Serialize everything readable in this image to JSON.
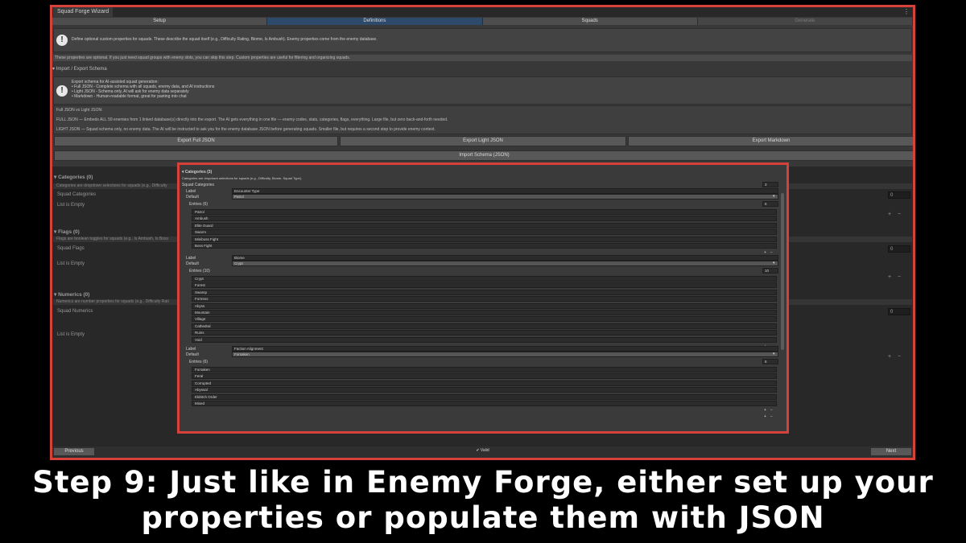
{
  "window": {
    "title": "Squad Forge Wizard",
    "menu_icon": "kebab-icon"
  },
  "tabs": [
    {
      "label": "Setup",
      "state": "normal"
    },
    {
      "label": "Definitions",
      "state": "active"
    },
    {
      "label": "Squads",
      "state": "normal"
    },
    {
      "label": "Generate",
      "state": "disabled"
    }
  ],
  "intro": {
    "help": "Define optional custom properties for squads. These describe the squad itself (e.g., Difficulty Rating, Biome, Is Ambush). Enemy properties come from the enemy database.",
    "note": "These properties are optional. If you just need squad groups with enemy slots, you can skip this step. Custom properties are useful for filtering and organizing squads."
  },
  "import_export": {
    "heading": "Import / Export Schema",
    "help": "Export schema for AI-assisted squad generation:\n• Full JSON - Complete schema with all squads, enemy data, and AI instructions\n• Light JSON - Schema only, AI will ask for enemy data separately\n• Markdown - Human-readable format, great for pasting into chat",
    "compare_title": "Full JSON vs Light JSON:",
    "full_desc": "FULL JSON — Embeds ALL 59 enemies from 1 linked database(s) directly into the export. The AI gets everything in one file — enemy codes, stats, categories, flags, everything. Large file, but zero back-and-forth needed.",
    "light_desc": "LIGHT JSON — Squad schema only, no enemy data. The AI will be instructed to ask you for the enemy database JSON before generating squads. Smaller file, but requires a second step to provide enemy context.",
    "export_full": "Export Full JSON",
    "export_light": "Export Light JSON",
    "export_md": "Export Markdown",
    "import": "Import Schema (JSON)"
  },
  "categories": {
    "heading": "Categories (0)",
    "desc": "Categories are dropdown selections for squads (e.g., Difficulty",
    "label": "Squad Categories",
    "count": "0",
    "empty": "List is Empty"
  },
  "flags": {
    "heading": "Flags (0)",
    "desc": "Flags are boolean toggles for squads (e.g., Is Ambush, Is Boss",
    "label": "Squad Flags",
    "count": "0",
    "empty": "List is Empty"
  },
  "numerics": {
    "heading": "Numerics (0)",
    "desc": "Numerics are number properties for squads (e.g., Difficulty Rati",
    "label": "Squad Numerics",
    "count": "0",
    "empty": "List is Empty"
  },
  "footer": {
    "previous": "Previous",
    "valid": "✔ Valid",
    "next": "Next"
  },
  "inset": {
    "heading": "Categories (3)",
    "desc": "Categories are dropdown selections for squads (e.g., Difficulty, Biome, Squad Type).",
    "list_label": "Squad Categories",
    "list_count": "3",
    "label_key": "Label",
    "default_key": "Default",
    "entries_key": "Entries",
    "groups": [
      {
        "label": "Encounter Type",
        "default": "Patrol",
        "entries_count": "(6)",
        "count": "6",
        "entries": [
          "Patrol",
          "Ambush",
          "Elite Guard",
          "Swarm",
          "Miniboss Fight",
          "Boss Fight"
        ]
      },
      {
        "label": "Biome",
        "default": "Crypt",
        "entries_count": "(10)",
        "count": "10",
        "entries": [
          "Crypt",
          "Forest",
          "Swamp",
          "Fortress",
          "Abyss",
          "Mountain",
          "Village",
          "Cathedral",
          "Ruins",
          "Void"
        ]
      },
      {
        "label": "Faction Alignment",
        "default": "Forsaken",
        "entries_count": "(6)",
        "count": "6",
        "entries": [
          "Forsaken",
          "Feral",
          "Corrupted",
          "Abyssal",
          "Eldritch Order",
          "Mixed"
        ]
      }
    ]
  },
  "caption": {
    "line1": "Step 9: Just like in Enemy Forge, either set up your",
    "line2": "properties or populate them with JSON"
  }
}
